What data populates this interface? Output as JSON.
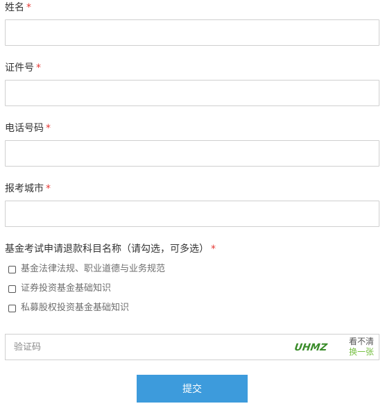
{
  "form": {
    "required_mark": "*",
    "fields": [
      {
        "label": "姓名",
        "value": "",
        "placeholder": ""
      },
      {
        "label": "证件号",
        "value": "",
        "placeholder": ""
      },
      {
        "label": "电话号码",
        "value": "",
        "placeholder": ""
      },
      {
        "label": "报考城市",
        "value": "",
        "placeholder": ""
      }
    ],
    "subjects": {
      "label": "基金考试申请退款科目名称（请勾选，可多选）",
      "options": [
        {
          "label": "基金法律法规、职业道德与业务规范",
          "checked": false
        },
        {
          "label": "证券投资基金基础知识",
          "checked": false
        },
        {
          "label": "私募股权投资基金基础知识",
          "checked": false
        }
      ]
    },
    "captcha": {
      "placeholder": "验证码",
      "value": "",
      "image_text": "UHMZ",
      "refresh_line1": "看不清",
      "refresh_line2": "换一张"
    },
    "submit_label": "提交"
  },
  "colors": {
    "required": "#e53935",
    "submit_bg": "#3d9bdc",
    "captcha_text": "#3a8c2a",
    "refresh_link": "#77c043",
    "input_border": "#cfcfcf"
  }
}
